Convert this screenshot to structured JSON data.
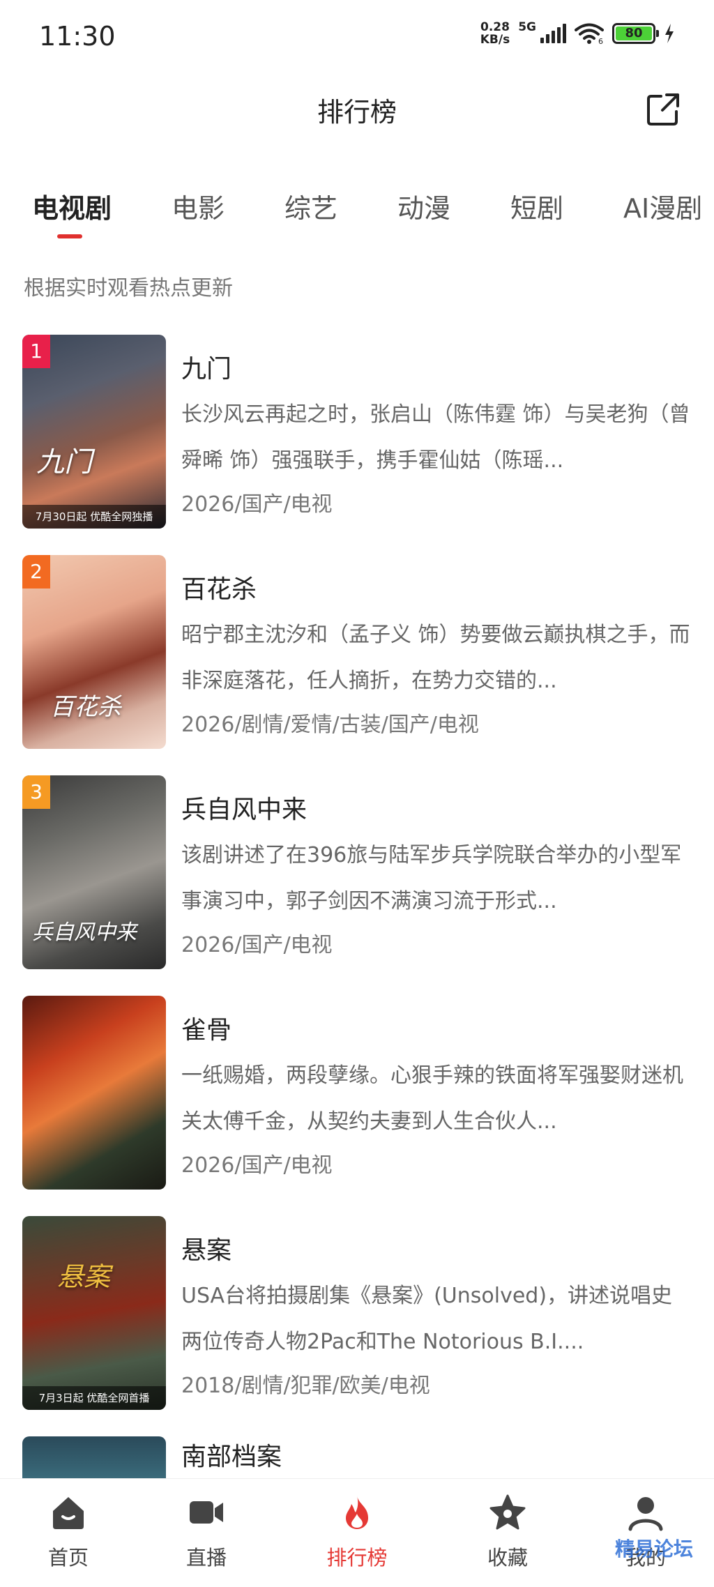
{
  "status_bar": {
    "time": "11:30",
    "net_speed_value": "0.28",
    "net_speed_unit": "KB/s",
    "network_gen": "5G",
    "wifi_sub": "6",
    "battery": "80",
    "icons": [
      "signal-icon",
      "wifi-icon",
      "battery-icon",
      "charging-icon"
    ]
  },
  "header": {
    "title": "排行榜",
    "share_icon": "share-external-icon"
  },
  "tabs": [
    {
      "label": "电视剧",
      "active": true
    },
    {
      "label": "电影",
      "active": false
    },
    {
      "label": "综艺",
      "active": false
    },
    {
      "label": "动漫",
      "active": false
    },
    {
      "label": "短剧",
      "active": false
    },
    {
      "label": "AI漫剧",
      "active": false
    }
  ],
  "subtitle": "根据实时观看热点更新",
  "items": [
    {
      "rank": "1",
      "title": "九门",
      "desc": "长沙风云再起之时，张启山（陈伟霆 饰）与吴老狗（曾舜晞 饰）强强联手，携手霍仙姑（陈瑶...",
      "meta": "2026/国产/电视",
      "poster_caption": "7月30日起 优酷全网独播",
      "poster_text": "九门",
      "badge_color": "#e8204a"
    },
    {
      "rank": "2",
      "title": "百花杀",
      "desc": "昭宁郡主沈汐和（孟子义 饰）势要做云巅执棋之手，而非深庭落花，任人摘折，在势力交错的...",
      "meta": "2026/剧情/爱情/古装/国产/电视",
      "poster_caption": "",
      "poster_text": "百花杀",
      "badge_color": "#f26a21"
    },
    {
      "rank": "3",
      "title": "兵自风中来",
      "desc": "该剧讲述了在396旅与陆军步兵学院联合举办的小型军事演习中，郭子剑因不满演习流于形式...",
      "meta": "2026/国产/电视",
      "poster_caption": "",
      "poster_text": "兵自风中来",
      "badge_color": "#f59a23"
    },
    {
      "rank": "",
      "title": "雀骨",
      "desc": "一纸赐婚，两段孽缘。心狠手辣的铁面将军强娶财迷机关太傅千金，从契约夫妻到人生合伙人...",
      "meta": "2026/国产/电视",
      "poster_caption": "",
      "poster_text": "",
      "badge_color": ""
    },
    {
      "rank": "",
      "title": "悬案",
      "desc": "USA台将拍摄剧集《悬案》(Unsolved)，讲述说唱史两位传奇人物2Pac和The Notorious B.I....",
      "meta": "2018/剧情/犯罪/欧美/电视",
      "poster_caption": "7月3日起 优酷全网首播",
      "poster_text": "悬案",
      "badge_color": ""
    },
    {
      "rank": "",
      "title": "南部档案",
      "desc": "",
      "meta": "",
      "poster_caption": "",
      "poster_text": "",
      "badge_color": ""
    }
  ],
  "bottom_nav": [
    {
      "label": "首页",
      "icon": "home-icon",
      "active": false
    },
    {
      "label": "直播",
      "icon": "video-camera-icon",
      "active": false
    },
    {
      "label": "排行榜",
      "icon": "flame-icon",
      "active": true
    },
    {
      "label": "收藏",
      "icon": "star-icon",
      "active": false
    },
    {
      "label": "我的",
      "icon": "user-icon",
      "active": false
    }
  ],
  "watermark": "精易论坛",
  "colors": {
    "accent": "#e53935",
    "text_primary": "#222222",
    "text_secondary": "#666666"
  }
}
